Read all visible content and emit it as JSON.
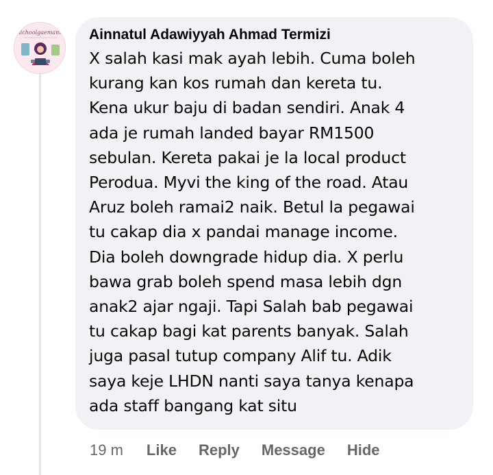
{
  "comment": {
    "avatar_caption": "nichoolgaemama",
    "author": "Ainnatul Adawiyyah Ahmad Termizi",
    "lines": [
      "X salah kasi mak ayah lebih. Cuma boleh",
      "kurang kan kos rumah dan kereta tu.",
      "Kena ukur baju di badan sendiri. Anak 4",
      "ada je rumah landed bayar RM1500",
      "sebulan. Kereta pakai je la local product",
      "Perodua. Myvi the king of the road. Atau",
      "Aruz boleh ramai2 naik. Betul la pegawai",
      "tu cakap dia x pandai manage income.",
      "Dia boleh downgrade hidup dia. X perlu",
      "bawa grab boleh spend masa lebih dgn",
      "anak2 ajar ngaji. Tapi Salah bab pegawai",
      "tu cakap bagi kat parents banyak. Salah",
      "juga pasal tutup company Alif tu. Adik",
      "saya keje LHDN nanti saya tanya kenapa",
      "ada staff bangang kat situ"
    ]
  },
  "actions": {
    "time": "19 m",
    "like": "Like",
    "reply": "Reply",
    "message": "Message",
    "hide": "Hide"
  },
  "colors": {
    "bubble": "#f0f2f5",
    "text": "#050505",
    "secondary_text": "#65676b",
    "thread_line": "#e4e6eb"
  }
}
